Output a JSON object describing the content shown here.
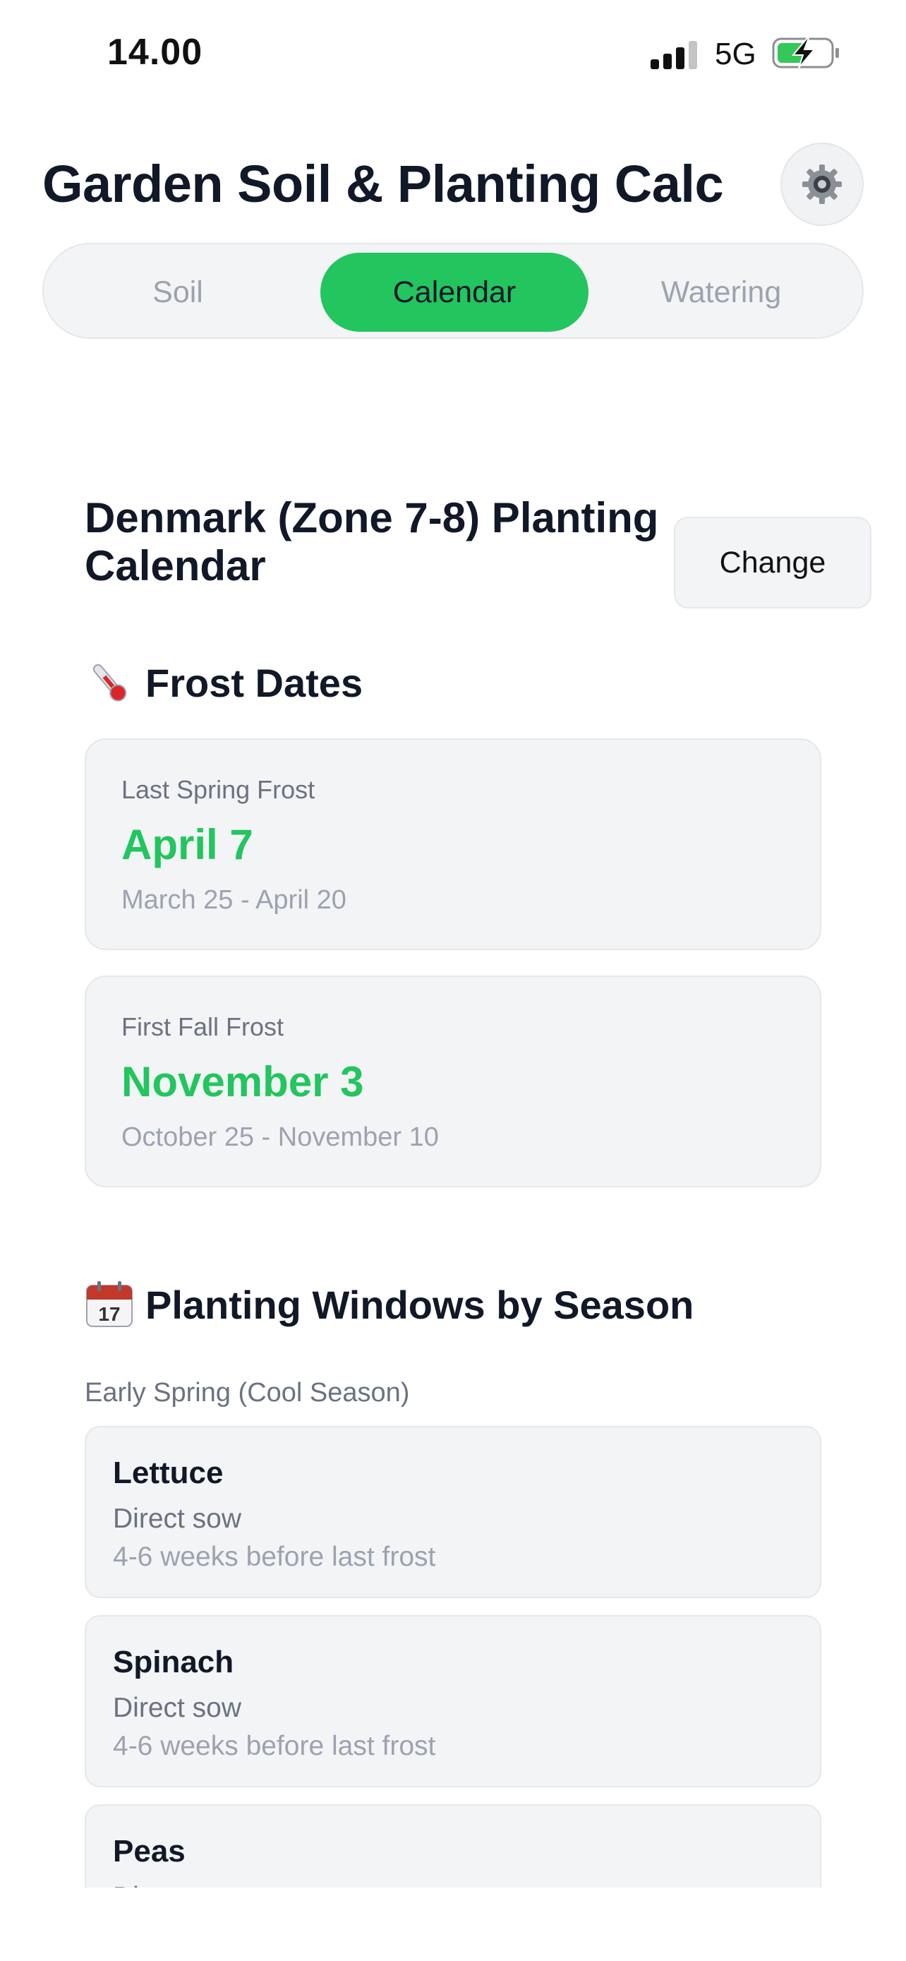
{
  "status_bar": {
    "time": "14.00",
    "network": "5G"
  },
  "header": {
    "title": "Garden Soil & Planting Calc"
  },
  "tabs": [
    {
      "label": "Soil",
      "active": false
    },
    {
      "label": "Calendar",
      "active": true
    },
    {
      "label": "Watering",
      "active": false
    }
  ],
  "calendar": {
    "title": "Denmark (Zone 7-8) Planting Calendar",
    "change_label": "Change"
  },
  "frost": {
    "heading": "Frost Dates",
    "heading_icon": "thermometer-icon",
    "cards": [
      {
        "label": "Last Spring Frost",
        "date": "April 7",
        "range": "March 25 - April 20"
      },
      {
        "label": "First Fall Frost",
        "date": "November 3",
        "range": "October 25 - November 10"
      }
    ]
  },
  "planting": {
    "heading": "Planting Windows by Season",
    "heading_icon": "calendar-icon",
    "season_label": "Early Spring (Cool Season)",
    "crops": [
      {
        "name": "Lettuce",
        "method": "Direct sow",
        "timing": "4-6 weeks before last frost"
      },
      {
        "name": "Spinach",
        "method": "Direct sow",
        "timing": "4-6 weeks before last frost"
      },
      {
        "name": "Peas",
        "method": "Direct sow",
        "timing": ""
      }
    ]
  },
  "colors": {
    "accent": "#22c55e",
    "card_bg": "#f3f4f6",
    "text": "#111827",
    "muted": "#6b7280"
  }
}
